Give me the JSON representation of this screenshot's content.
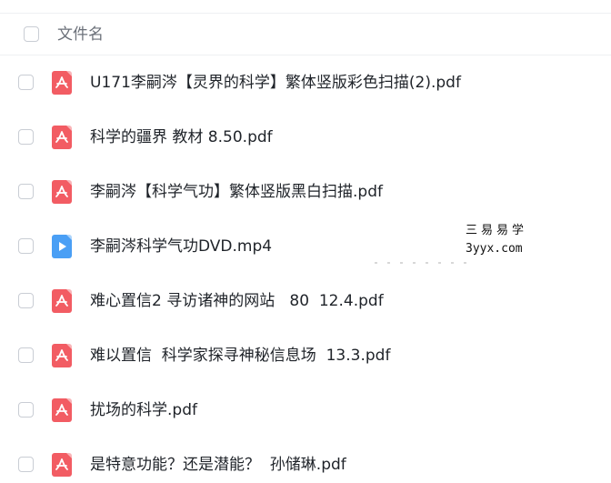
{
  "header": {
    "column_label": "文件名"
  },
  "files": [
    {
      "name": "U171李嗣涔【灵界的科学】繁体竖版彩色扫描(2).pdf",
      "icon": "pdf-file-icon"
    },
    {
      "name": "科学的疆界 教材 8.50.pdf",
      "icon": "pdf-file-icon"
    },
    {
      "name": "李嗣涔【科学气功】繁体竖版黑白扫描.pdf",
      "icon": "pdf-file-icon"
    },
    {
      "name": "李嗣涔科学气功DVD.mp4",
      "icon": "video-file-icon"
    },
    {
      "name": "难心置信2 寻访诸神的网站   80  12.4.pdf",
      "icon": "pdf-file-icon"
    },
    {
      "name": "难以置信  科学家探寻神秘信息场  13.3.pdf",
      "icon": "pdf-file-icon"
    },
    {
      "name": "扰场的科学.pdf",
      "icon": "pdf-file-icon"
    },
    {
      "name": "是特意功能？还是潜能？  孙储琳.pdf",
      "icon": "pdf-file-icon"
    }
  ],
  "watermark": {
    "line1": "三易易学",
    "line2": "3yyx.com"
  },
  "colors": {
    "pdf_icon": "#f25c63",
    "video_icon": "#4a9ff5",
    "checkbox_border": "#c9cdd4",
    "header_text": "#6b7079",
    "file_text": "#1f2329"
  }
}
